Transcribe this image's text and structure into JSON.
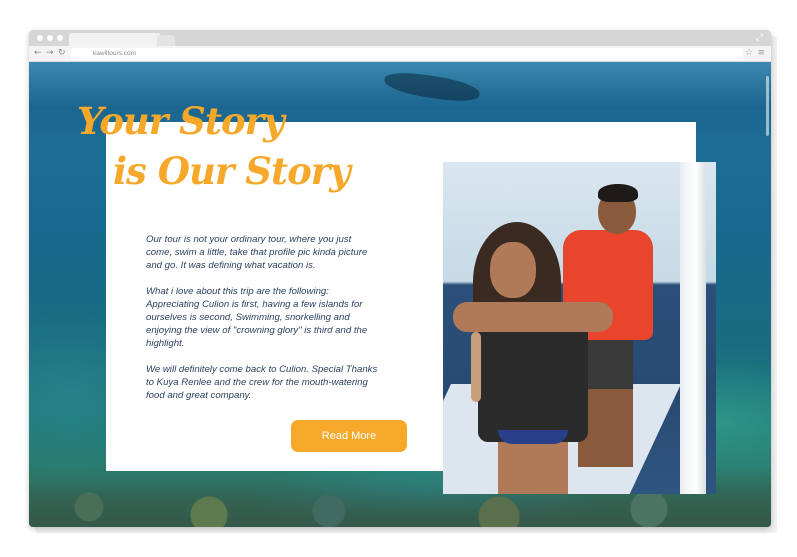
{
  "browser": {
    "url": "kawiltours.com",
    "icons": {
      "back": "arrow-left-icon",
      "forward": "arrow-right-icon",
      "reload": "reload-icon",
      "bookmark": "star-icon",
      "menu": "hamburger-menu-icon",
      "resize": "expand-icon"
    }
  },
  "story": {
    "headline_line1": "Your Story",
    "headline_line2": "is Our Story",
    "paragraphs": [
      "Our tour is not your ordinary tour, where you just come, swim a little, take that profile pic kinda picture and go. It was defining what vacation is.",
      "What i love about this trip are the following: Appreciating Culion is first, having a few islands for ourselves is second, Swimming, snorkelling and enjoying the view of \"crowning glory\" is third and the highlight.",
      "We will definitely come back to Culion. Special Thanks to Kuya Renlee and the crew for the mouth-watering food and great company."
    ],
    "read_more_label": "Read More"
  },
  "colors": {
    "accent": "#f6a82b",
    "body_text": "#2a3f5f",
    "card_bg": "#ffffff"
  }
}
